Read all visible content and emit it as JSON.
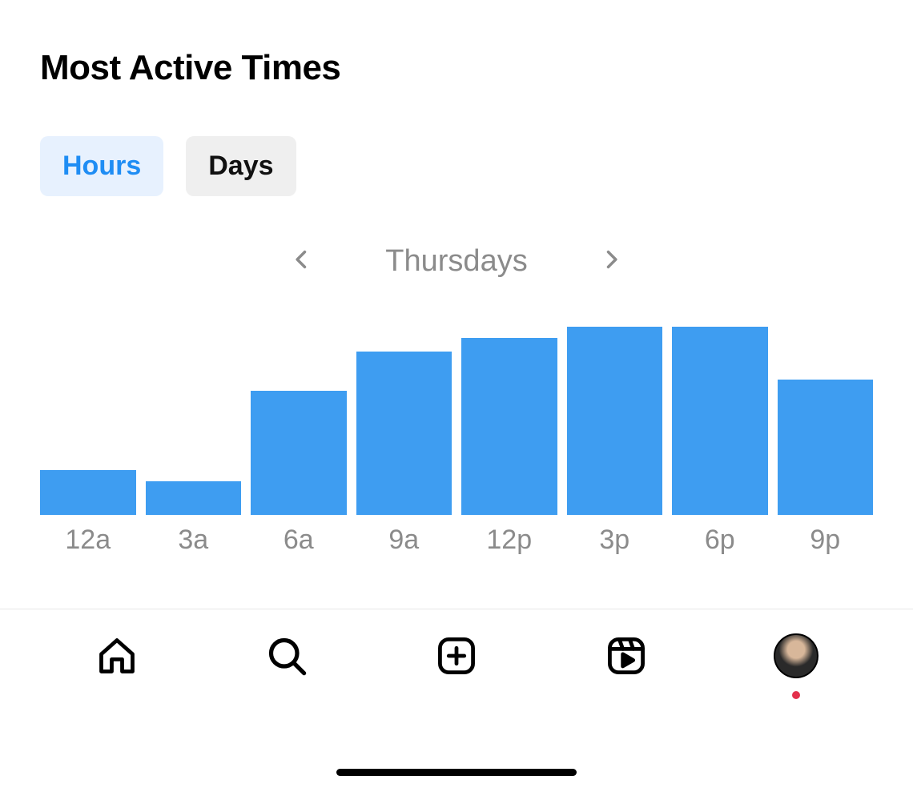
{
  "title": "Most Active Times",
  "tabs": {
    "hours": "Hours",
    "days": "Days",
    "active": "hours"
  },
  "selector": {
    "day": "Thursdays"
  },
  "chart_data": {
    "type": "bar",
    "categories": [
      "12a",
      "3a",
      "6a",
      "9a",
      "12p",
      "3p",
      "6p",
      "9p"
    ],
    "values": [
      24,
      18,
      66,
      87,
      94,
      100,
      100,
      72
    ],
    "title": "Most Active Times",
    "xlabel": "",
    "ylabel": "",
    "ylim": [
      0,
      100
    ],
    "note": "Values are relative bar heights (percent of max) read from the screenshot; no numeric axis labels are shown."
  },
  "colors": {
    "bar": "#3e9df1",
    "tab_active_bg": "#e7f1fe",
    "tab_active_fg": "#1f8df4",
    "tab_inactive_bg": "#efefef",
    "label": "#8b8b8b"
  },
  "tabbar": {
    "home": "home-icon",
    "search": "search-icon",
    "create": "plus-icon",
    "reels": "reels-icon",
    "profile": "profile-avatar",
    "profile_notification": true
  }
}
